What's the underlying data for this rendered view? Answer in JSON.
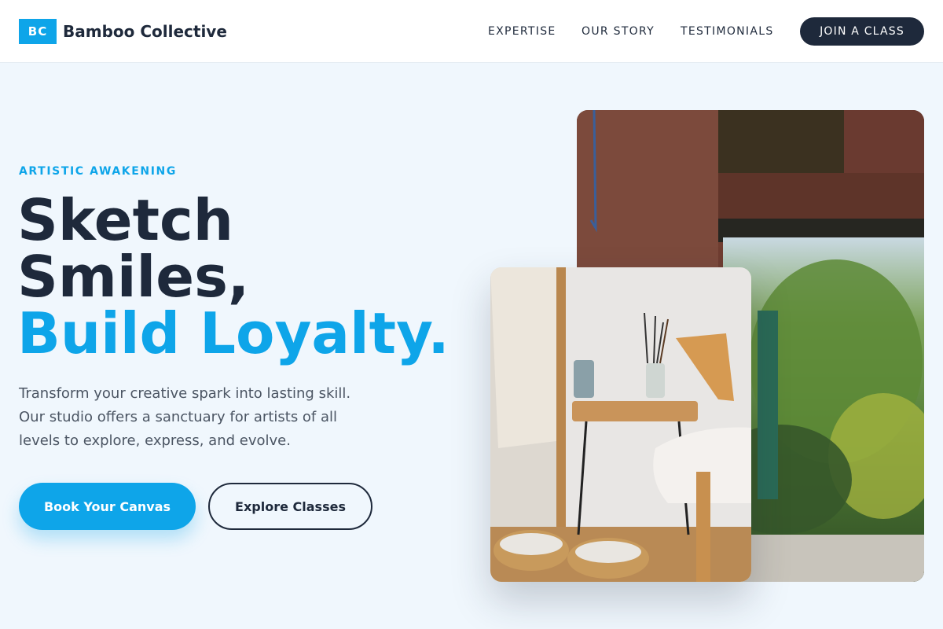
{
  "header": {
    "logo_badge": "BC",
    "brand_name": "Bamboo Collective",
    "nav": [
      {
        "label": "EXPERTISE"
      },
      {
        "label": "OUR STORY"
      },
      {
        "label": "TESTIMONIALS"
      }
    ],
    "cta_label": "JOIN A CLASS"
  },
  "hero": {
    "eyebrow": "ARTISTIC AWAKENING",
    "headline_line1": "Sketch",
    "headline_line2": "Smiles,",
    "headline_accent": "Build Loyalty.",
    "description": "Transform your creative spark into lasting skill. Our studio offers a sanctuary for artists of all levels to explore, express, and evolve.",
    "primary_button": "Book Your Canvas",
    "secondary_button": "Explore Classes"
  },
  "images": {
    "back_photo": "studio-window-garden-photo",
    "front_photo": "art-supplies-easel-photo"
  },
  "colors": {
    "accent": "#0ea5e9",
    "dark": "#1e293b",
    "background": "#f0f7fd",
    "body_text": "#4b5563"
  }
}
